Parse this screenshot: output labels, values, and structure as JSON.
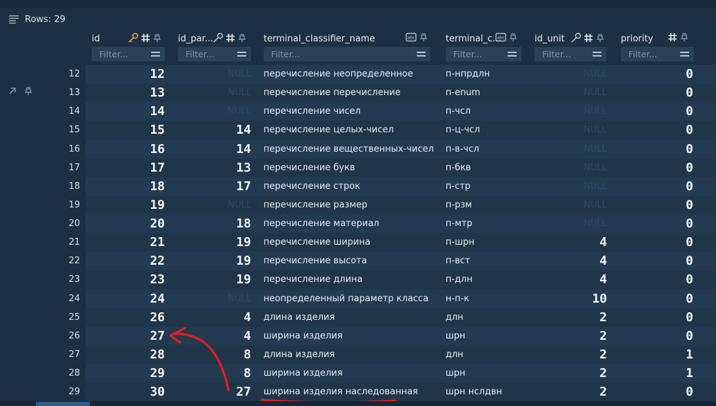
{
  "header": {
    "rows_label": "Rows: 29"
  },
  "columns": [
    {
      "key": "id",
      "label": "id",
      "filter_placeholder": "Filter..."
    },
    {
      "key": "id_parent",
      "label": "id_par...",
      "filter_placeholder": "Filter..."
    },
    {
      "key": "name",
      "label": "terminal_classifier_name",
      "filter_placeholder": "Filter..."
    },
    {
      "key": "short",
      "label": "terminal_c...",
      "filter_placeholder": "Filter..."
    },
    {
      "key": "id_unit",
      "label": "id_unit",
      "filter_placeholder": "Filter..."
    },
    {
      "key": "priority",
      "label": "priority",
      "filter_placeholder": "Filter..."
    }
  ],
  "null_text": "NULL",
  "rows": [
    {
      "n": "12",
      "id": "12",
      "id_parent": null,
      "name": "перечисление неопределенное",
      "short": "п-нпрдлн",
      "id_unit": null,
      "priority": "0"
    },
    {
      "n": "13",
      "id": "13",
      "id_parent": null,
      "name": "перечисление перечисление",
      "short": "п-enum",
      "id_unit": null,
      "priority": "0"
    },
    {
      "n": "14",
      "id": "14",
      "id_parent": null,
      "name": "перечисление чисел",
      "short": "п-чсл",
      "id_unit": null,
      "priority": "0"
    },
    {
      "n": "15",
      "id": "15",
      "id_parent": "14",
      "name": "перечисление целых-чисел",
      "short": "п-ц-чсл",
      "id_unit": null,
      "priority": "0"
    },
    {
      "n": "16",
      "id": "16",
      "id_parent": "14",
      "name": "перечисление вещественных-чисел",
      "short": "п-в-чсл",
      "id_unit": null,
      "priority": "0"
    },
    {
      "n": "17",
      "id": "17",
      "id_parent": "13",
      "name": "перечисление букв",
      "short": "п-бкв",
      "id_unit": null,
      "priority": "0"
    },
    {
      "n": "18",
      "id": "18",
      "id_parent": "17",
      "name": "перечисление строк",
      "short": "п-стр",
      "id_unit": null,
      "priority": "0"
    },
    {
      "n": "19",
      "id": "19",
      "id_parent": null,
      "name": "перечисление размер",
      "short": "п-рзм",
      "id_unit": null,
      "priority": "0"
    },
    {
      "n": "20",
      "id": "20",
      "id_parent": "18",
      "name": "перечисление материал",
      "short": "п-мтр",
      "id_unit": null,
      "priority": "0"
    },
    {
      "n": "21",
      "id": "21",
      "id_parent": "19",
      "name": "перечисление ширина",
      "short": "п-шрн",
      "id_unit": "4",
      "priority": "0"
    },
    {
      "n": "22",
      "id": "22",
      "id_parent": "19",
      "name": "перечисление высота",
      "short": "п-вст",
      "id_unit": "4",
      "priority": "0"
    },
    {
      "n": "23",
      "id": "23",
      "id_parent": "19",
      "name": "перечисление длина",
      "short": "п-длн",
      "id_unit": "4",
      "priority": "0"
    },
    {
      "n": "24",
      "id": "24",
      "id_parent": null,
      "name": "неопределенный параметр класса",
      "short": "н-п-к",
      "id_unit": "10",
      "priority": "0"
    },
    {
      "n": "25",
      "id": "26",
      "id_parent": "4",
      "name": "длина изделия",
      "short": "длн",
      "id_unit": "2",
      "priority": "0"
    },
    {
      "n": "26",
      "id": "27",
      "id_parent": "4",
      "name": "ширина изделия",
      "short": "шрн",
      "id_unit": "2",
      "priority": "0"
    },
    {
      "n": "27",
      "id": "28",
      "id_parent": "8",
      "name": "длина изделия",
      "short": "длн",
      "id_unit": "2",
      "priority": "1"
    },
    {
      "n": "28",
      "id": "29",
      "id_parent": "8",
      "name": "ширина изделия",
      "short": "шрн",
      "id_unit": "2",
      "priority": "1"
    },
    {
      "n": "29",
      "id": "30",
      "id_parent": "27",
      "name": "ширина изделия наследованная",
      "short": "шрн нслдвн",
      "id_unit": "2",
      "priority": "0"
    }
  ],
  "colors": {
    "background": "#1d2f42",
    "row_odd": "#213549",
    "row_even": "#243a50",
    "filter_bg": "#2a4157",
    "key_icon": "#e8a33d",
    "annotation": "#e02020"
  },
  "icons": {
    "rows_bar": "list-icon",
    "row_tools": [
      "expand-arrow-icon",
      "pin-icon"
    ],
    "id": [
      "primary-key-icon",
      "hash-icon",
      "pin-icon"
    ],
    "id_parent": [
      "foreign-key-icon",
      "hash-icon",
      "pin-icon"
    ],
    "name": [
      "text-type-icon",
      "pin-icon"
    ],
    "short": [
      "text-type-icon",
      "pin-icon"
    ],
    "id_unit": [
      "foreign-key-icon",
      "hash-icon",
      "pin-icon"
    ],
    "priority": [
      "hash-icon",
      "pin-icon"
    ]
  }
}
